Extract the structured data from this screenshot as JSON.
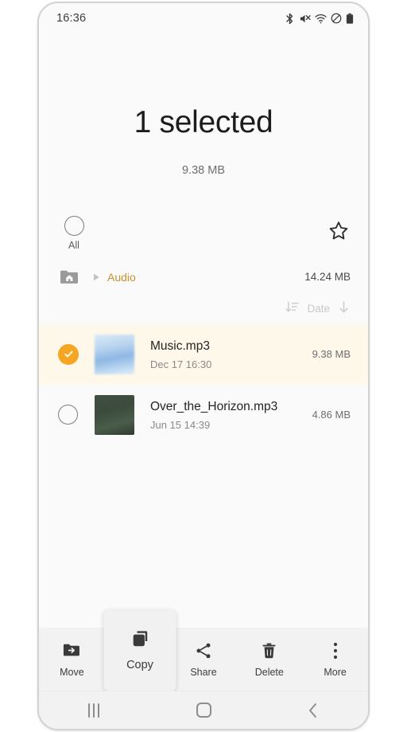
{
  "status_bar": {
    "time": "16:36",
    "icons": [
      "bluetooth-icon",
      "volume-mute-icon",
      "wifi-icon",
      "do-not-disturb-icon",
      "battery-icon"
    ]
  },
  "header": {
    "title": "1 selected",
    "subtitle": "9.38 MB"
  },
  "select_all": {
    "label": "All",
    "checked": false,
    "favorite_icon": "star-outline-icon"
  },
  "breadcrumb": {
    "home_icon": "home-folder-icon",
    "separator_icon": "chevron-right-icon",
    "current": "Audio",
    "total_size": "14.24 MB"
  },
  "sort_bar": {
    "sort_icon": "sort-lines-icon",
    "label": "Date",
    "direction_icon": "arrow-down-icon"
  },
  "files": [
    {
      "name": "Music.mp3",
      "date": "Dec 17 16:30",
      "size": "9.38 MB",
      "selected": true,
      "thumb": "blue-sky-thumbnail"
    },
    {
      "name": "Over_the_Horizon.mp3",
      "date": "Jun 15 14:39",
      "size": "4.86 MB",
      "selected": false,
      "thumb": "dark-green-thumbnail"
    }
  ],
  "action_bar": {
    "items": [
      {
        "label": "Move",
        "icon": "move-folder-icon",
        "active": false
      },
      {
        "label": "Copy",
        "icon": "copy-icon",
        "active": true
      },
      {
        "label": "Share",
        "icon": "share-icon",
        "active": false
      },
      {
        "label": "Delete",
        "icon": "trash-icon",
        "active": false
      },
      {
        "label": "More",
        "icon": "more-vertical-icon",
        "active": false
      }
    ]
  },
  "nav_bar": {
    "recents": "recents-icon",
    "home": "home-icon",
    "back": "back-icon"
  },
  "colors": {
    "accent_orange": "#f5a623",
    "breadcrumb_orange": "#c8912f",
    "selected_row_bg": "#fdf8ea",
    "bar_bg": "#f2f2f2",
    "screen_bg": "#fafafa"
  }
}
